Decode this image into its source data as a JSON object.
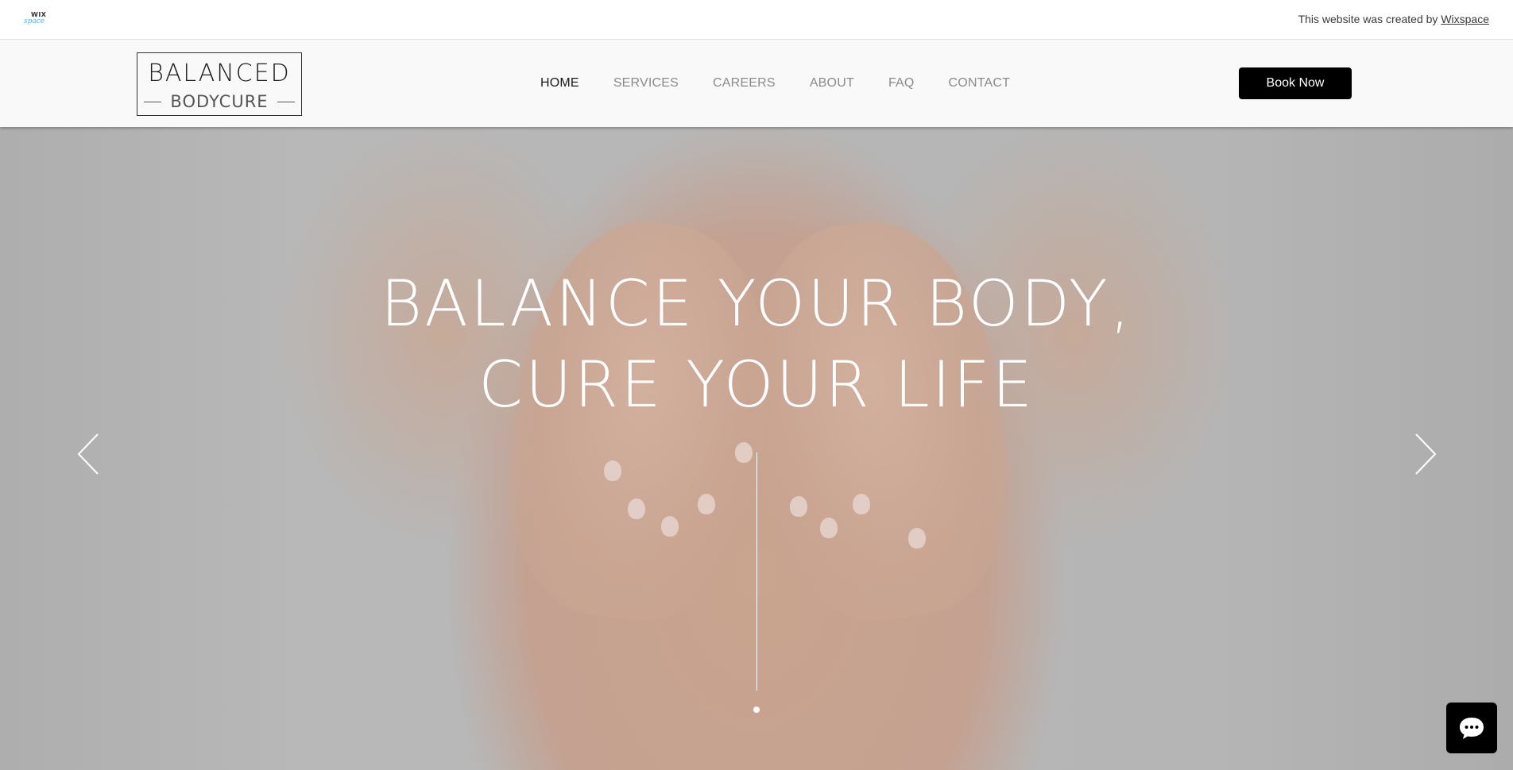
{
  "banner": {
    "logo_top": "WIX",
    "logo_bottom": "space",
    "created_text": "This website was created by",
    "created_link": "Wixspace"
  },
  "header": {
    "brand_top": "BALANCED",
    "brand_bottom": "BODYCURE",
    "nav": [
      {
        "label": "HOME",
        "active": true
      },
      {
        "label": "SERVICES",
        "active": false
      },
      {
        "label": "CAREERS",
        "active": false
      },
      {
        "label": "ABOUT",
        "active": false
      },
      {
        "label": "FAQ",
        "active": false
      },
      {
        "label": "CONTACT",
        "active": false
      }
    ],
    "book_button": "Book Now"
  },
  "hero": {
    "title_line1": "BALANCE YOUR BODY,",
    "title_line2": "CURE YOUR LIFE",
    "prev_icon": "chevron-left-icon",
    "next_icon": "chevron-right-icon",
    "slide_count": 1,
    "active_slide": 1
  },
  "chat": {
    "icon": "chat-bubble-icon"
  },
  "colors": {
    "accent": "#000000",
    "nav_inactive": "#8a8a8a",
    "nav_active": "#1a1a1a",
    "wix_blue": "#4fb6e3"
  }
}
